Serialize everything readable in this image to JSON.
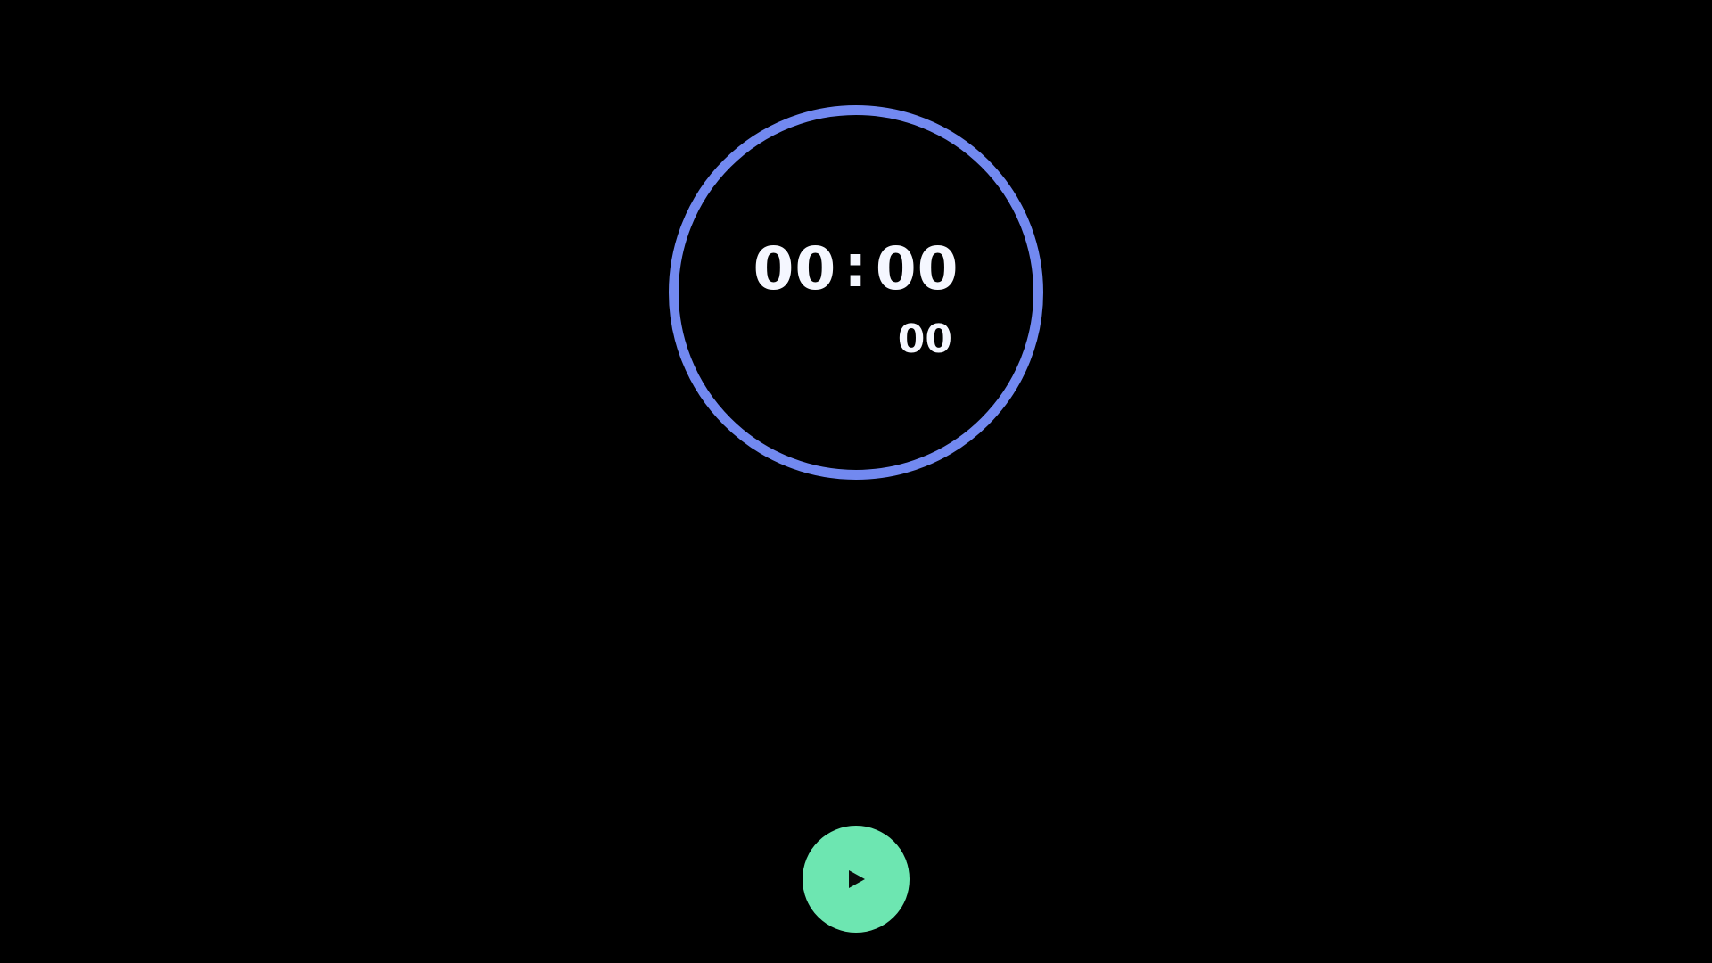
{
  "timer": {
    "minutes": "00",
    "separator": ":",
    "seconds": "00",
    "centiseconds": "00"
  },
  "controls": {
    "play_icon": "play-icon"
  },
  "colors": {
    "background": "#000000",
    "ring": "#7289f0",
    "digits": "#f5f7ff",
    "play_button": "#6de6b1",
    "play_glyph": "#0a0a0a"
  }
}
